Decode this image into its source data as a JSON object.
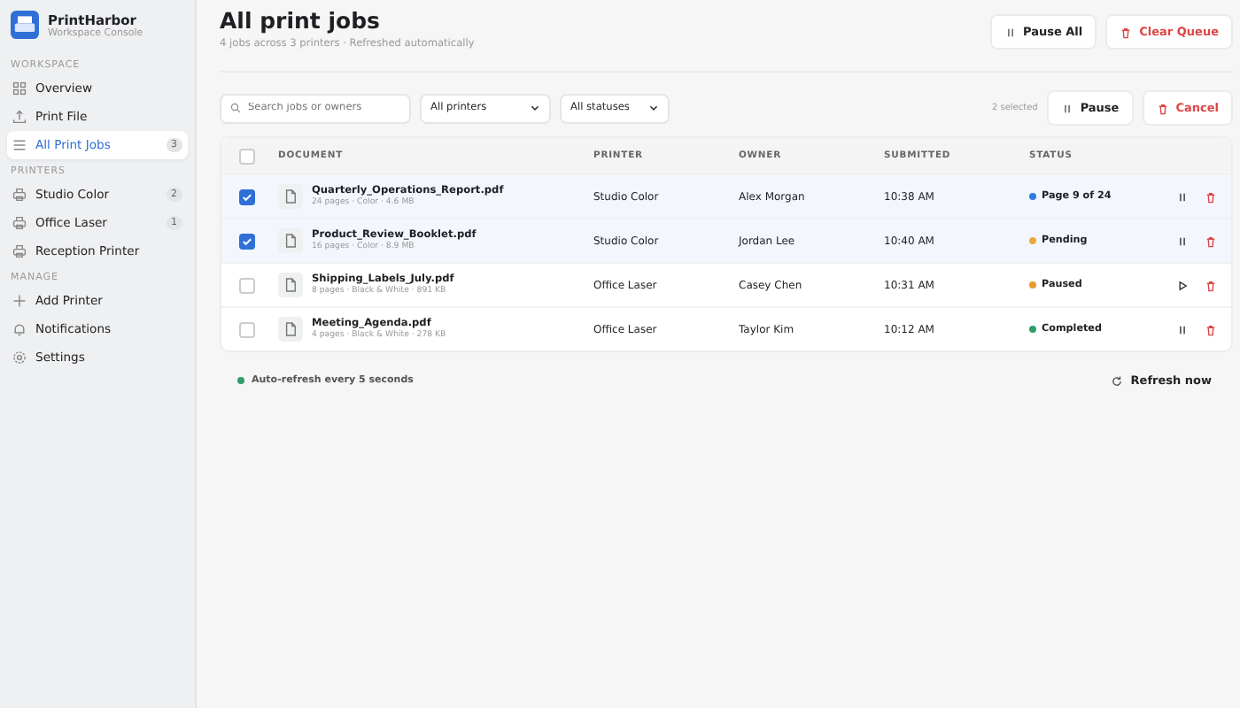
{
  "brand": {
    "name": "PrintHarbor",
    "subtitle": "Workspace Console"
  },
  "sidebar": [
    {
      "heading": "WORKSPACE",
      "items": [
        {
          "label": "Overview",
          "kind": "grid",
          "selected": false
        },
        {
          "label": "Print File",
          "kind": "upload",
          "selected": false
        },
        {
          "label": "All Print Jobs",
          "kind": "list",
          "selected": true,
          "count": "3"
        }
      ]
    },
    {
      "heading": "PRINTERS",
      "items": [
        {
          "label": "Studio Color",
          "kind": "printer",
          "selected": false,
          "count": "2"
        },
        {
          "label": "Office Laser",
          "kind": "printer",
          "selected": false,
          "count": "1"
        },
        {
          "label": "Reception Printer",
          "kind": "printer",
          "selected": false
        }
      ]
    },
    {
      "heading": "MANAGE",
      "items": [
        {
          "label": "Add Printer",
          "kind": "plus",
          "selected": false
        },
        {
          "label": "Notifications",
          "kind": "bell",
          "selected": false
        },
        {
          "label": "Settings",
          "kind": "gear",
          "selected": false
        }
      ]
    }
  ],
  "header": {
    "title": "All print jobs",
    "subtitle": "4 jobs across 3 printers · Refreshed automatically",
    "buttons": [
      {
        "label": "Pause All",
        "kind": "pause"
      },
      {
        "label": "Clear Queue",
        "kind": "danger"
      }
    ]
  },
  "toolbar": {
    "search": {
      "placeholder": "Search jobs or owners"
    },
    "filters": [
      "All printers",
      "All statuses"
    ],
    "selection_count": "2 selected",
    "buttons": [
      {
        "label": "Pause",
        "kind": "pause"
      },
      {
        "label": "Cancel",
        "kind": "danger"
      }
    ]
  },
  "table": {
    "select_all_checked": false,
    "columns": [
      "DOCUMENT",
      "PRINTER",
      "OWNER",
      "SUBMITTED",
      "STATUS"
    ],
    "rows": [
      {
        "checked": true,
        "name": "Quarterly_Operations_Report.pdf",
        "meta": "24 pages · Color · 4.6 MB",
        "printer": "Studio Color",
        "owner": "Alex Morgan",
        "submitted": "10:38 AM",
        "status": "Page 9 of 24",
        "color": "#2f7de1",
        "paused": false
      },
      {
        "checked": true,
        "name": "Product_Review_Booklet.pdf",
        "meta": "16 pages · Color · 8.9 MB",
        "printer": "Studio Color",
        "owner": "Jordan Lee",
        "submitted": "10:40 AM",
        "status": "Pending",
        "color": "#e8a93a",
        "paused": false
      },
      {
        "checked": false,
        "name": "Shipping_Labels_July.pdf",
        "meta": "8 pages · Black & White · 891 KB",
        "printer": "Office Laser",
        "owner": "Casey Chen",
        "submitted": "10:31 AM",
        "status": "Paused",
        "color": "#e89a2e",
        "paused": true
      },
      {
        "checked": false,
        "name": "Meeting_Agenda.pdf",
        "meta": "4 pages · Black & White · 278 KB",
        "printer": "Office Laser",
        "owner": "Taylor Kim",
        "submitted": "10:12 AM",
        "status": "Completed",
        "color": "#2e9e6a",
        "paused": false
      }
    ]
  },
  "footer": {
    "auto_refresh": "Auto-refresh every 5 seconds",
    "refresh_button": "Refresh now"
  }
}
